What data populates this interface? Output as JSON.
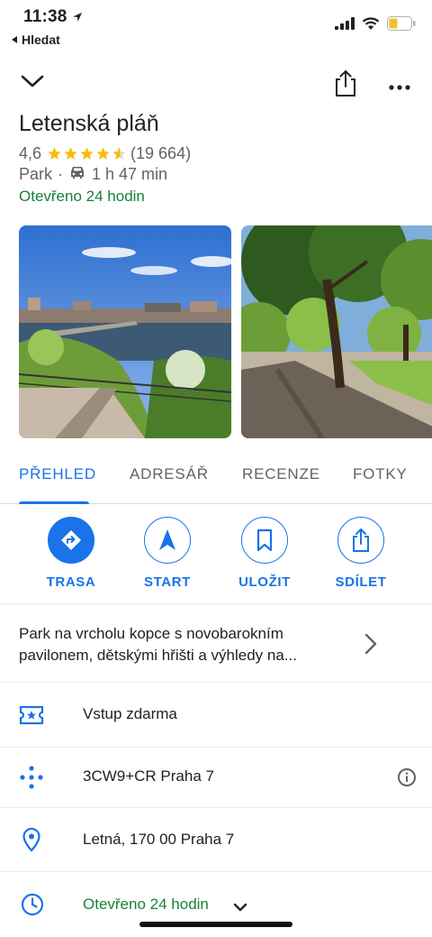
{
  "status_bar": {
    "time": "11:38",
    "back_label": "Hledat"
  },
  "place": {
    "name": "Letenská pláň",
    "rating": "4,6",
    "rating_value": 4.6,
    "reviews": "(19 664)",
    "category": "Park",
    "travel_time": "1 h 47 min",
    "open_status": "Otevřeno 24 hodin"
  },
  "tabs": [
    {
      "label": "PŘEHLED",
      "active": true
    },
    {
      "label": "ADRESÁŘ",
      "active": false
    },
    {
      "label": "RECENZE",
      "active": false
    },
    {
      "label": "FOTKY",
      "active": false
    }
  ],
  "actions": [
    {
      "label": "TRASA",
      "icon": "directions-icon"
    },
    {
      "label": "START",
      "icon": "navigation-icon"
    },
    {
      "label": "ULOŽIT",
      "icon": "bookmark-icon"
    },
    {
      "label": "SDÍLET",
      "icon": "share-icon"
    }
  ],
  "description": "Park na vrcholu kopce s novobarokním pavilonem, dětskými hřišti a výhledy na...",
  "details": {
    "admission": "Vstup zdarma",
    "plus_code": "3CW9+CR Praha 7",
    "address": "Letná, 170 00 Praha 7",
    "hours": "Otevřeno 24 hodin"
  },
  "colors": {
    "accent": "#1a73e8",
    "open_green": "#188038",
    "star": "#fbbc04"
  }
}
